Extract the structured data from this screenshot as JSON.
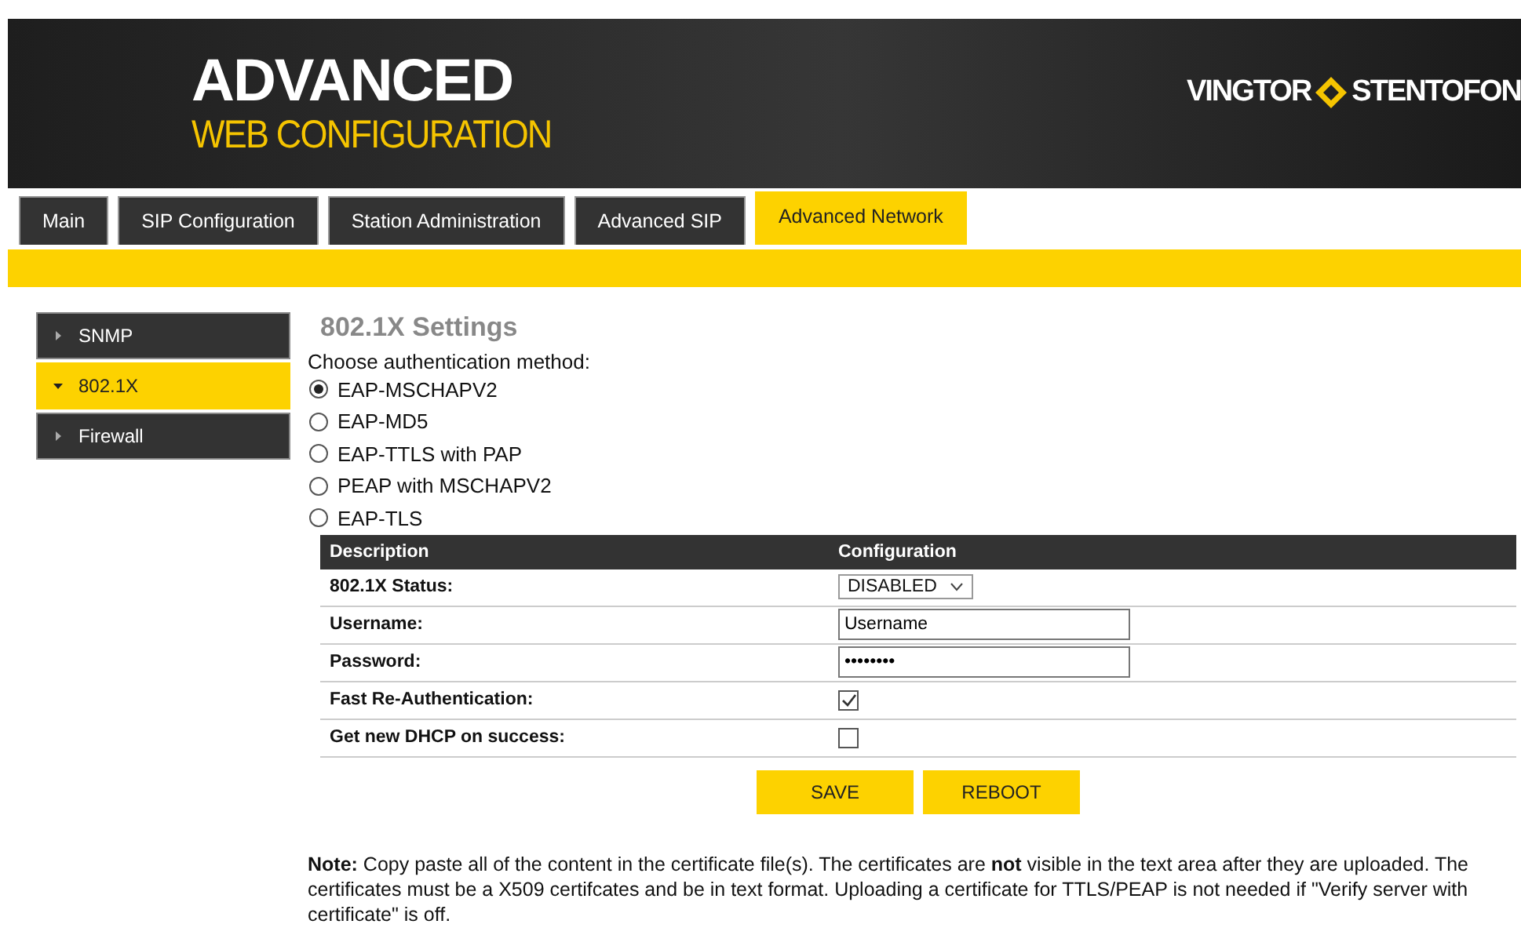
{
  "header": {
    "title": "ADVANCED",
    "subtitle": "WEB CONFIGURATION",
    "brand_left": "VINGTOR",
    "brand_right": "STENTOFON"
  },
  "tabs": [
    {
      "label": "Main",
      "selected": false
    },
    {
      "label": "SIP Configuration",
      "selected": false
    },
    {
      "label": "Station Administration",
      "selected": false
    },
    {
      "label": "Advanced SIP",
      "selected": false
    },
    {
      "label": "Advanced Network",
      "selected": true
    }
  ],
  "sidebar": {
    "items": [
      {
        "label": "SNMP",
        "selected": false,
        "expanded": false
      },
      {
        "label": "802.1X",
        "selected": true,
        "expanded": true
      },
      {
        "label": "Firewall",
        "selected": false,
        "expanded": false
      }
    ]
  },
  "content": {
    "heading": "802.1X Settings",
    "prompt": "Choose authentication method:",
    "methods": [
      {
        "label": "EAP-MSCHAPV2",
        "selected": true
      },
      {
        "label": "EAP-MD5",
        "selected": false
      },
      {
        "label": "EAP-TTLS with PAP",
        "selected": false
      },
      {
        "label": "PEAP with MSCHAPV2",
        "selected": false
      },
      {
        "label": "EAP-TLS",
        "selected": false
      }
    ],
    "table": {
      "columns": [
        "Description",
        "Configuration"
      ],
      "rows": [
        {
          "kind": "select",
          "label": "802.1X Status:",
          "value": "DISABLED"
        },
        {
          "kind": "text",
          "label": "Username:",
          "value": "Username"
        },
        {
          "kind": "text",
          "label": "Password:",
          "value": "••••••••"
        },
        {
          "kind": "checkbox",
          "label": "Fast Re-Authentication:",
          "checked": true
        },
        {
          "kind": "checkbox",
          "label": "Get new DHCP on success:",
          "checked": false
        }
      ]
    },
    "buttons": [
      "SAVE",
      "REBOOT"
    ],
    "note": "**Note:** Copy paste all of the content in the certificate file(s). The certificates are **not** visible in the text area after they are uploaded. The certificates must be a X509 certifcates and be in text format. Uploading a certificate for TTLS/PEAP is not needed if \"Verify server with certificate\" is off."
  }
}
